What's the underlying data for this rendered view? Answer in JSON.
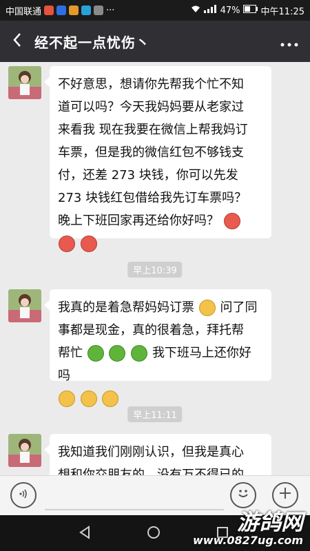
{
  "status_bar": {
    "carrier": "中国联通",
    "battery": "47%",
    "time": "中午11:25"
  },
  "nav": {
    "title": "经不起一点忧伤丶"
  },
  "messages": [
    {
      "type": "received",
      "lines": [
        "不好意思，想请你先帮我个忙不知",
        "道可以吗？今天我妈妈要从老家过",
        "来看我 现在我要在微信上帮我妈订",
        "车票，但是我的微信红包不够钱支",
        "付，还差 273 块钱，你可以先发",
        "273 块钱红包借给我先订车票吗？",
        "晚上下班回家再还给你好吗？"
      ]
    },
    {
      "type": "time",
      "text": "早上10:39"
    },
    {
      "type": "received",
      "lines": [
        "我真的是着急帮妈妈订票",
        "问了同",
        "事都是现金，真的很着急，拜托帮",
        "帮忙",
        "我下班马上还你好吗"
      ]
    },
    {
      "type": "time",
      "text": "早上11:11"
    },
    {
      "type": "received",
      "lines": [
        "我知道我们刚刚认识，但我是真心",
        "想和你交朋友的，没有万不得已的"
      ]
    }
  ],
  "icons": {
    "back": "chevron-left-icon",
    "more": "more-dots-icon",
    "voice": "voice-icon",
    "emoji": "emoji-icon",
    "plus": "plus-icon"
  },
  "watermark": {
    "line1": "游鸽网",
    "line2": "www.0827ug.com"
  },
  "colors": {
    "nav_bg": "#2f2f34",
    "chat_bg": "#ebebeb",
    "bubble_bg": "#ffffff"
  }
}
